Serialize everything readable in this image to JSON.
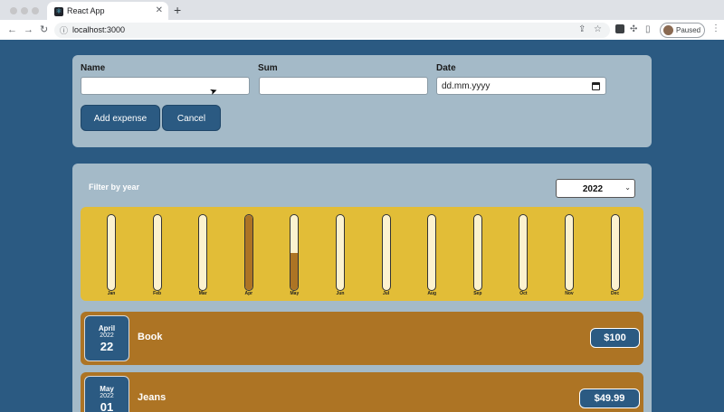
{
  "browser": {
    "tab_title": "React App",
    "tab_favicon": "react-logo-icon",
    "close_glyph": "✕",
    "new_tab_glyph": "+",
    "url": "localhost:3000",
    "profile_label": "Paused",
    "icons": [
      "back-icon",
      "forward-icon",
      "reload-icon",
      "info-icon",
      "share-icon",
      "bookmark-star-icon",
      "extension-icon",
      "puzzle-icon",
      "sidebar-icon",
      "menu-icon"
    ]
  },
  "form": {
    "name_label": "Name",
    "sum_label": "Sum",
    "date_label": "Date",
    "name_value": "",
    "sum_value": "",
    "date_placeholder": "dd.mm.yyyy",
    "add_button": "Add expense",
    "cancel_button": "Cancel"
  },
  "filter": {
    "label": "Filter by year",
    "selected_year": "2022"
  },
  "chart_data": {
    "type": "bar",
    "categories": [
      "Jan",
      "Feb",
      "Mar",
      "Apr",
      "May",
      "Jun",
      "Jul",
      "Aug",
      "Sep",
      "Oct",
      "Nov",
      "Dec"
    ],
    "values": [
      0,
      0,
      0,
      100,
      49.99,
      0,
      0,
      0,
      0,
      0,
      0,
      0
    ],
    "ylim": [
      0,
      100
    ],
    "grid": false,
    "colors": {
      "track": "#fcf2cf",
      "fill": "#ad7424",
      "background": "#e2bd37"
    }
  },
  "expenses": [
    {
      "month": "April",
      "year": "2022",
      "day": "22",
      "title": "Book",
      "amount": "$100"
    },
    {
      "month": "May",
      "year": "2022",
      "day": "01",
      "title": "Jeans",
      "amount": "$49.99"
    }
  ],
  "colors": {
    "page_bg": "#2b5a82",
    "card_bg": "#a4bac8",
    "button_bg": "#2b5a82",
    "expense_bg": "#ad7424",
    "chart_bg": "#e2bd37"
  }
}
